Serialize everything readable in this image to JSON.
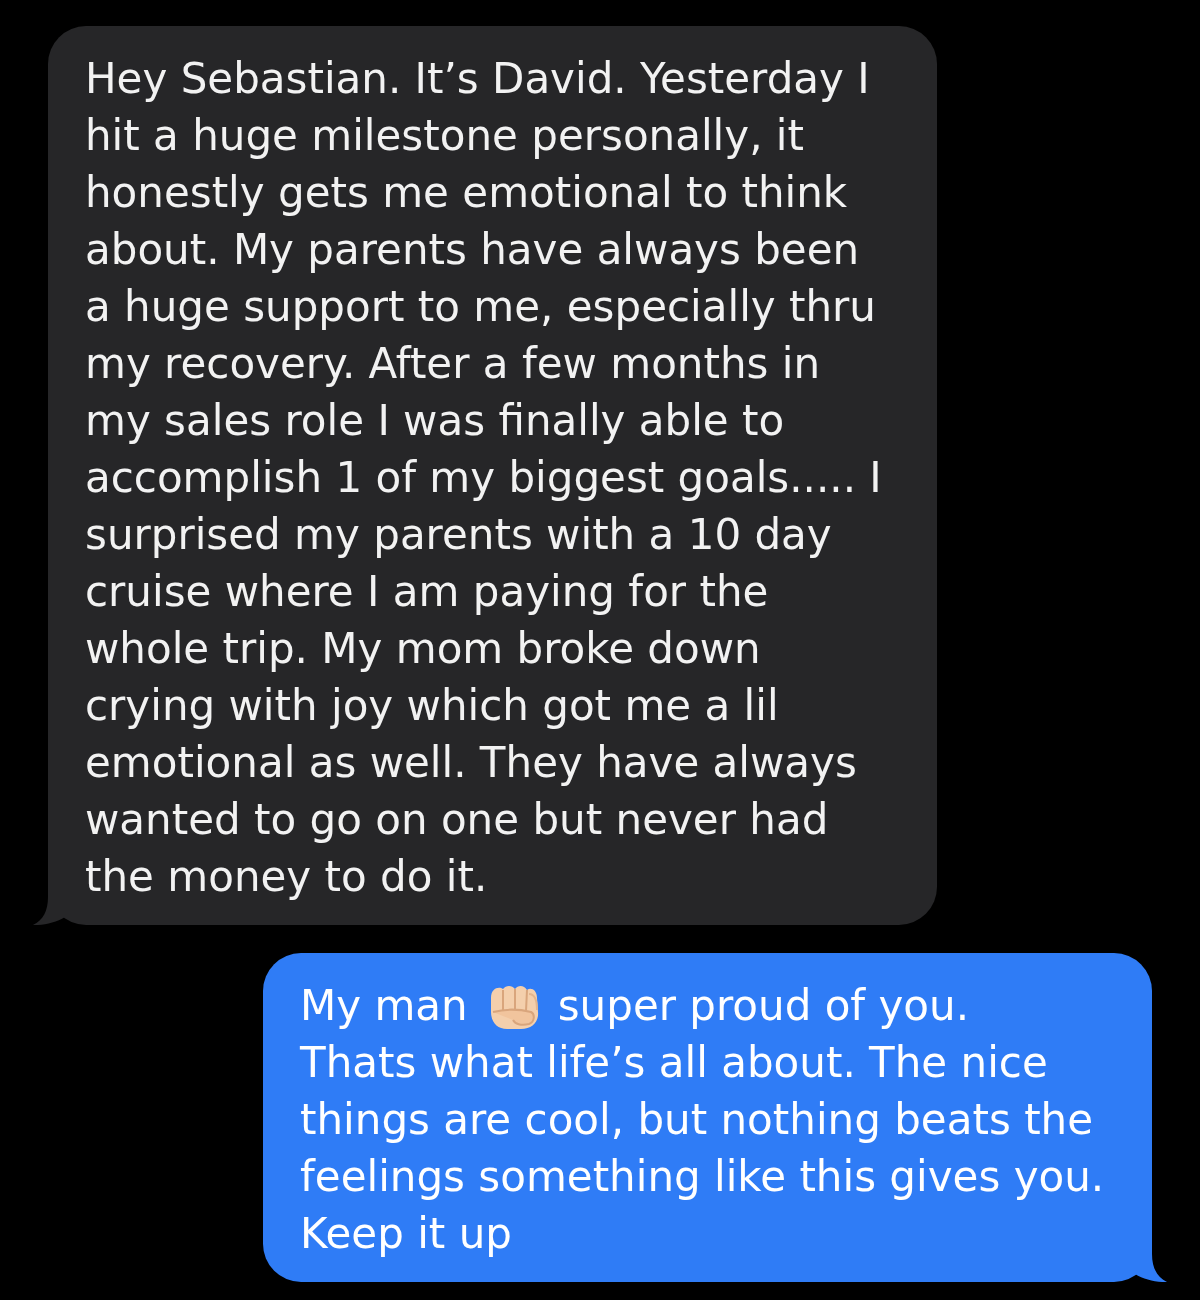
{
  "messages": [
    {
      "kind": "received",
      "blocks": [
        {
          "segments": [
            {
              "kind": "text",
              "text": "Hey Sebastian. It’s David. Yesterday I hit a huge milestone personally, it honestly gets me emotional to think about. My parents have always been a huge support to me, especially thru my recovery. After a few months in my sales role I was finally able to accomplish 1 of my biggest goals..... I surprised my parents with a 10 day cruise where I am paying for the whole trip. My mom broke down crying with joy which got me a lil emotional as well. They have always wanted to go on one but never had the money to do it."
            }
          ]
        }
      ]
    },
    {
      "kind": "sent",
      "blocks": [
        {
          "segments": [
            {
              "kind": "text",
              "text": "My man"
            },
            {
              "kind": "emoji"
            },
            {
              "kind": "text",
              "text": "super proud of you."
            }
          ]
        },
        {
          "segments": [
            {
              "kind": "text",
              "text": "Thats what life’s all about. The nice things are cool, but nothing beats the feelings something like this gives you. Keep it up"
            }
          ]
        }
      ]
    }
  ]
}
